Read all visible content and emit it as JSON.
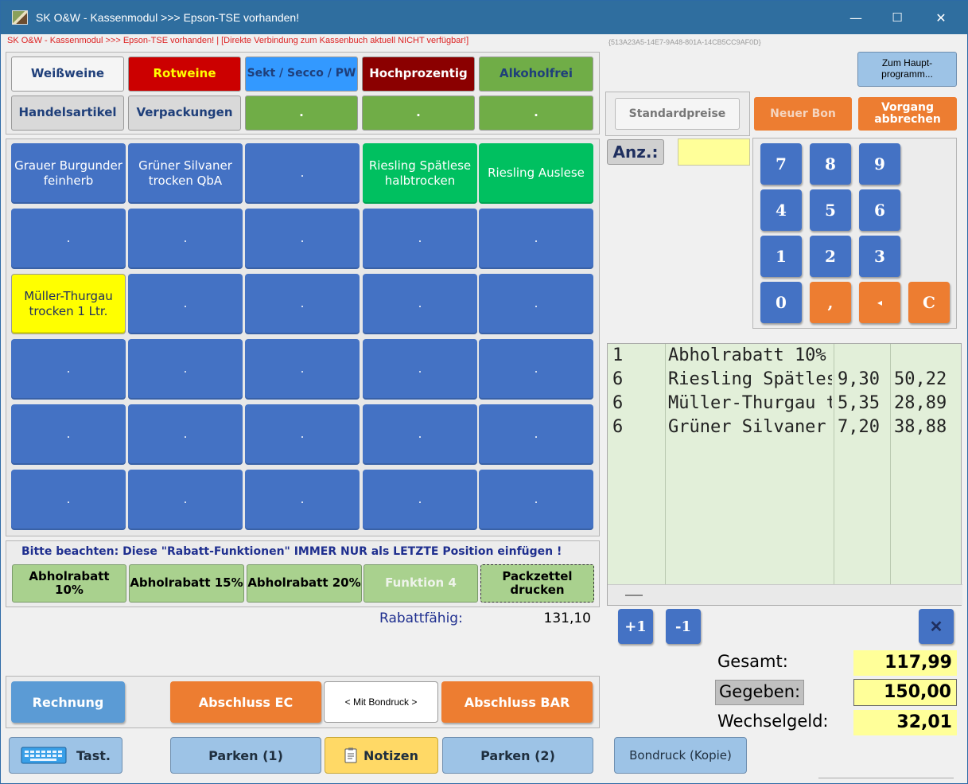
{
  "window": {
    "title": "SK O&W - Kassenmodul >>> Epson-TSE vorhanden!",
    "minimize": "—",
    "maximize": "☐",
    "close": "✕"
  },
  "status_line": "SK O&W - Kassenmodul >>> Epson-TSE vorhanden! | [Direkte Verbindung zum Kassenbuch aktuell NICHT verfügbar!]",
  "guid": "{513A23A5-14E7-9A48-801A-14CB5CC9AF0D}",
  "categories": {
    "row1": [
      "Weißweine",
      "Rotweine",
      "Sekt / Secco / PW",
      "Hochprozentig",
      "Alkoholfrei"
    ],
    "row2": [
      "Handelsartikel",
      "Verpackungen",
      ".",
      ".",
      "."
    ]
  },
  "products": [
    [
      "Grauer Burgunder feinherb",
      "Grüner Silvaner trocken QbA",
      ".",
      "Riesling Spätlese halbtrocken",
      "Riesling Auslese"
    ],
    [
      ".",
      ".",
      ".",
      ".",
      "."
    ],
    [
      "Müller-Thurgau trocken 1 Ltr.",
      ".",
      ".",
      ".",
      "."
    ],
    [
      ".",
      ".",
      ".",
      ".",
      "."
    ],
    [
      ".",
      ".",
      ".",
      ".",
      "."
    ],
    [
      ".",
      ".",
      ".",
      ".",
      "."
    ]
  ],
  "notice": "Bitte beachten: Diese \"Rabatt-Funktionen\" IMMER NUR als LETZTE Position einfügen !",
  "discounts": [
    "Abholrabatt 10%",
    "Abholrabatt 15%",
    "Abholrabatt 20%",
    "Funktion 4",
    "Packzettel drucken"
  ],
  "rabatt": {
    "label": "Rabattfähig:",
    "value": "131,10"
  },
  "right_top": {
    "main_program": "Zum Haupt-programm...",
    "standard_prices": "Standardpreise",
    "new_receipt": "Neuer Bon",
    "cancel": "Vorgang abbrechen"
  },
  "qty": {
    "label": "Anz.:",
    "value": ""
  },
  "keypad": [
    "7",
    "8",
    "9",
    "4",
    "5",
    "6",
    "1",
    "2",
    "3",
    "0",
    ",",
    "◂",
    "C"
  ],
  "receipt": {
    "rows": [
      {
        "qty": "1",
        "name": "Abholrabatt 10%",
        "price": "",
        "total": ""
      },
      {
        "qty": "6",
        "name": "Riesling Spätlese",
        "price": "9,30",
        "total": "50,22"
      },
      {
        "qty": "6",
        "name": "Müller-Thurgau tr",
        "price": "5,35",
        "total": "28,89"
      },
      {
        "qty": "6",
        "name": "Grüner Silvaner t",
        "price": "7,20",
        "total": "38,88"
      }
    ]
  },
  "line_buttons": {
    "plus": "+1",
    "minus": "-1",
    "delete": "✕"
  },
  "totals": {
    "gesamt_label": "Gesamt:",
    "gesamt": "117,99",
    "gegeben_label": "Gegeben:",
    "gegeben": "150,00",
    "wechsel_label": "Wechselgeld:",
    "wechsel": "32,01"
  },
  "actions": {
    "invoice": "Rechnung",
    "ec": "Abschluss EC",
    "bondruck": "< Mit Bondruck >",
    "bar": "Abschluss BAR"
  },
  "bottom": {
    "keyboard": "Tast.",
    "park1": "Parken (1)",
    "notes": "Notizen",
    "park2": "Parken (2)",
    "reprint": "Bondruck (Kopie)"
  },
  "colors": {
    "title": "#2f6e9f",
    "blue": "#4472c4",
    "orange": "#ed7d31",
    "green_prod": "#00c060",
    "yellow": "#ffff99",
    "receipt_bg": "#e2efd9"
  }
}
